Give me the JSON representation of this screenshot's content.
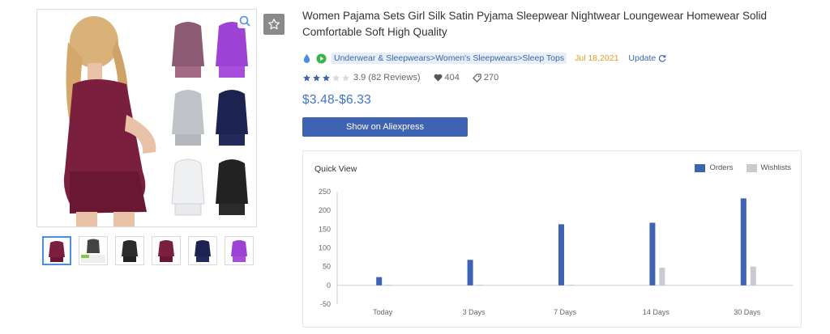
{
  "product": {
    "title": "Women Pajama Sets Girl Silk Satin Pyjama Sleepwear Nightwear Loungewear Homewear Solid Comfortable Soft High Quality",
    "category_path": "Underwear & Sleepwears>Women's Sleepwears>Sleep Tops",
    "date": "Jul 18,2021",
    "update_label": "Update",
    "rating": 3.9,
    "rating_text": "3.9 (82 Reviews)",
    "likes": "404",
    "tags": "270",
    "price": "$3.48-$6.33",
    "aliexpress_button": "Show on Aliexpress"
  },
  "icons": {
    "favorite": "star-outline-icon",
    "zoom": "zoom-icon",
    "drop": "drop-icon",
    "play": "play-icon",
    "heart": "heart-icon",
    "tag": "tag-icon",
    "refresh": "refresh-icon"
  },
  "colors": {
    "orders": "#3e63b3",
    "wishlists": "#c8cbd2",
    "price": "#3f74c9",
    "date": "#e59a1e",
    "link": "#3d67a8",
    "star": "#3e63b3"
  },
  "thumbnails": [
    "maroon-set",
    "white-set",
    "black-set",
    "maroon-set",
    "navy-set",
    "purple-set"
  ],
  "quick_view": {
    "title": "Quick View"
  },
  "chart_data": {
    "type": "bar",
    "categories": [
      "Today",
      "3 Days",
      "7 Days",
      "14 Days",
      "30 Days"
    ],
    "series": [
      {
        "name": "Orders",
        "values": [
          22,
          68,
          163,
          167,
          232
        ]
      },
      {
        "name": "Wishlists",
        "values": [
          2,
          2,
          2,
          47,
          50
        ]
      }
    ],
    "ylim": [
      -50,
      250
    ],
    "yticks": [
      250,
      200,
      150,
      100,
      50,
      0,
      -50
    ],
    "grid": false,
    "legend": "top-right"
  }
}
